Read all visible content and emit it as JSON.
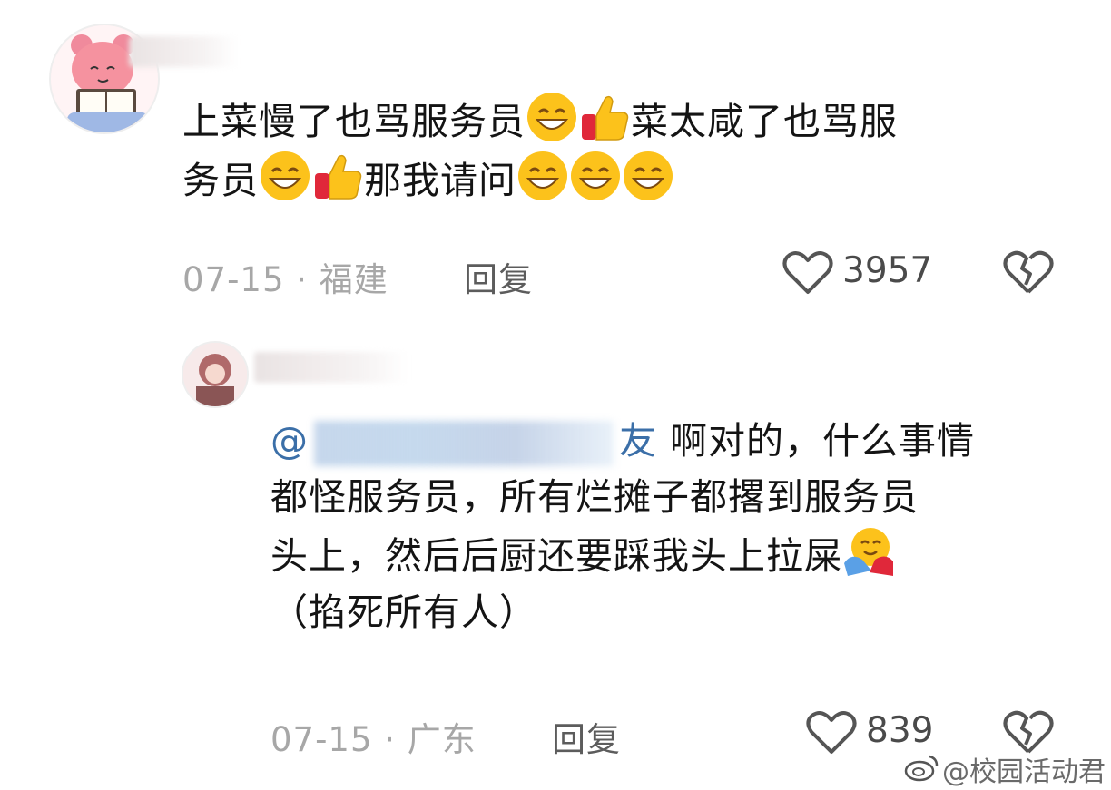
{
  "comments": [
    {
      "text_parts": [
        "上菜慢了也骂服务员",
        "菜太咸了也骂服",
        "务员",
        "那我请问"
      ],
      "meta": "07-15 · 福建",
      "reply_label": "回复",
      "likes": "3957"
    },
    {
      "mention_tail": "友",
      "mention_prefix": "@",
      "text_parts": [
        "啊对的，什么事情",
        "都怪服务员，所有烂摊子都撂到服务员",
        "头上，然后后厨还要踩我头上拉屎",
        "（掐死所有人）"
      ],
      "meta": "07-15 · 广东",
      "reply_label": "回复",
      "likes": "839"
    }
  ],
  "icons": {
    "grin": "grinning-face-icon",
    "thumbs_up": "thumbs-up-icon",
    "hug": "hugging-face-icon",
    "like": "heart-outline-icon",
    "dislike": "broken-heart-icon",
    "weibo": "weibo-logo-icon"
  },
  "watermark": "@校园活动君"
}
